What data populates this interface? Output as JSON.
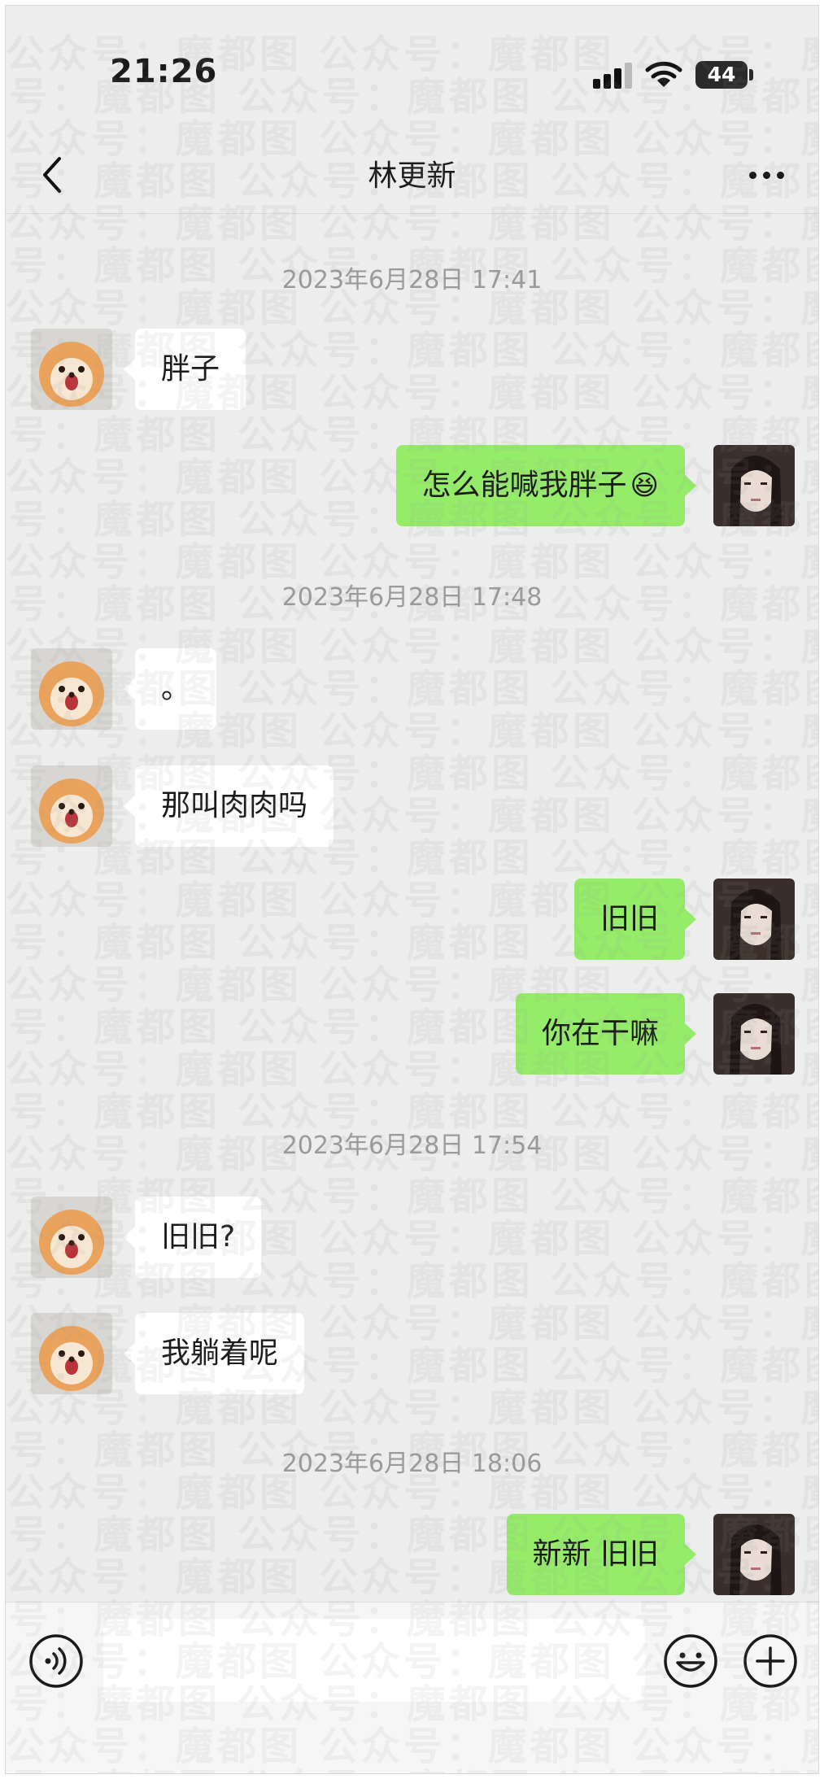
{
  "status_bar": {
    "time": "21:26",
    "battery": "44"
  },
  "nav": {
    "title": "林更新"
  },
  "messages": [
    {
      "type": "timestamp",
      "text": "2023年6月28日 17:41"
    },
    {
      "type": "message",
      "sender": "contact",
      "text": "胖子"
    },
    {
      "type": "message",
      "sender": "self",
      "text": "怎么能喊我胖子",
      "emoji": "😆"
    },
    {
      "type": "timestamp",
      "text": "2023年6月28日 17:48"
    },
    {
      "type": "message",
      "sender": "contact",
      "text": "。"
    },
    {
      "type": "message",
      "sender": "contact",
      "text": "那叫肉肉吗"
    },
    {
      "type": "message",
      "sender": "self",
      "text": "旧旧"
    },
    {
      "type": "message",
      "sender": "self",
      "text": "你在干嘛"
    },
    {
      "type": "timestamp",
      "text": "2023年6月28日 17:54"
    },
    {
      "type": "message",
      "sender": "contact",
      "text": "旧旧?"
    },
    {
      "type": "message",
      "sender": "contact",
      "text": "我躺着呢"
    },
    {
      "type": "timestamp",
      "text": "2023年6月28日 18:06"
    },
    {
      "type": "message",
      "sender": "self",
      "text": "新新 旧旧"
    }
  ],
  "watermark": {
    "text": "公众号：魔都图"
  },
  "input_bar": {
    "placeholder": ""
  },
  "icons": {
    "back": "chevron-left-icon",
    "more": "more-dots-icon",
    "voice": "voice-icon",
    "emoji": "emoji-icon",
    "plus": "plus-icon",
    "signal": "signal-icon",
    "wifi": "wifi-icon",
    "battery": "battery-icon"
  },
  "colors": {
    "background": "#ededed",
    "self_bubble": "#95ec69",
    "contact_bubble": "#ffffff",
    "timestamp": "#9a9a9a"
  }
}
